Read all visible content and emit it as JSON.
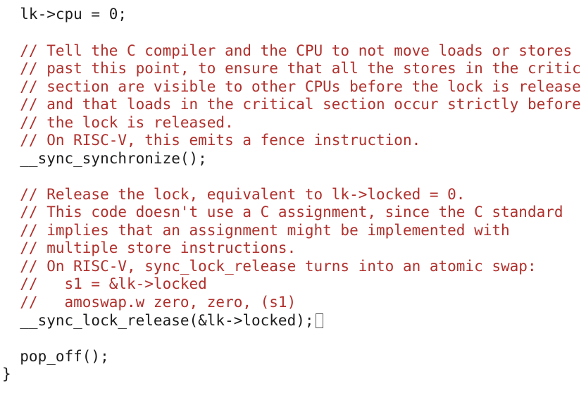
{
  "code_lines": [
    {
      "kind": "code",
      "text": "  lk->cpu = 0;"
    },
    {
      "kind": "blank",
      "text": ""
    },
    {
      "kind": "comment",
      "text": "  // Tell the C compiler and the CPU to not move loads or stores"
    },
    {
      "kind": "comment",
      "text": "  // past this point, to ensure that all the stores in the critic"
    },
    {
      "kind": "comment",
      "text": "  // section are visible to other CPUs before the lock is release"
    },
    {
      "kind": "comment",
      "text": "  // and that loads in the critical section occur strictly before"
    },
    {
      "kind": "comment",
      "text": "  // the lock is released."
    },
    {
      "kind": "comment",
      "text": "  // On RISC-V, this emits a fence instruction."
    },
    {
      "kind": "code",
      "text": "  __sync_synchronize();"
    },
    {
      "kind": "blank",
      "text": ""
    },
    {
      "kind": "comment",
      "text": "  // Release the lock, equivalent to lk->locked = 0."
    },
    {
      "kind": "comment",
      "text": "  // This code doesn't use a C assignment, since the C standard"
    },
    {
      "kind": "comment",
      "text": "  // implies that an assignment might be implemented with"
    },
    {
      "kind": "comment",
      "text": "  // multiple store instructions."
    },
    {
      "kind": "comment",
      "text": "  // On RISC-V, sync_lock_release turns into an atomic swap:"
    },
    {
      "kind": "comment",
      "text": "  //   s1 = &lk->locked"
    },
    {
      "kind": "comment",
      "text": "  //   amoswap.w zero, zero, (s1)"
    },
    {
      "kind": "code",
      "text": "  __sync_lock_release(&lk->locked);",
      "cursor": true
    },
    {
      "kind": "blank",
      "text": ""
    },
    {
      "kind": "code",
      "text": "  pop_off();"
    },
    {
      "kind": "code",
      "text": "}"
    }
  ],
  "colors": {
    "comment": "#b0302c",
    "code": "#1c1c1c",
    "background": "#ffffff"
  },
  "cursor_icon": "text-cursor-box"
}
